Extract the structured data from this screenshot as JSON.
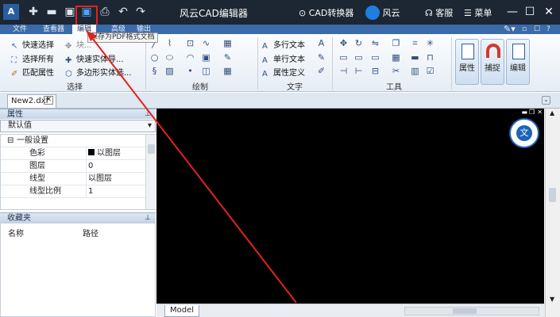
{
  "app": {
    "title": "风云CAD编辑器",
    "converter": "CAD转换器",
    "fengyun": "风云",
    "support": "客服",
    "menu": "菜单"
  },
  "menu_tabs": [
    "文件",
    "查看器",
    "编辑",
    "高级",
    "输出"
  ],
  "active_tab": "编辑",
  "tooltip": "保存为PDF格式文档",
  "ribbon": {
    "select_group": {
      "label": "选择",
      "items": [
        "快速选择",
        "选择所有",
        "匹配属性",
        "块...",
        "快速实体导...",
        "多边形实体选..."
      ]
    },
    "draw_group": {
      "label": "绘制"
    },
    "text_group": {
      "label": "文字",
      "items": [
        "多行文本",
        "单行文本",
        "属性定义"
      ]
    },
    "tools_group": {
      "label": "工具"
    },
    "big_buttons": [
      "属性",
      "捕捉",
      "编辑"
    ]
  },
  "document": {
    "tab": "New2.dxf",
    "model_tab": "Model"
  },
  "properties": {
    "title": "属性",
    "selector": "默认值",
    "section": "一般设置",
    "rows": [
      {
        "key": "色彩",
        "value": "以图层"
      },
      {
        "key": "图层",
        "value": "0"
      },
      {
        "key": "线型",
        "value": "以图层"
      },
      {
        "key": "线型比例",
        "value": "1"
      }
    ]
  },
  "favorites": {
    "title": "收藏夹",
    "col_name": "名称",
    "col_path": "路径"
  },
  "translate_icon": "translate-icon",
  "colors": {
    "titlebar": "#1c2733",
    "menubar": "#3a6aa8",
    "canvas": "#000000",
    "highlight": "#e0231d"
  }
}
